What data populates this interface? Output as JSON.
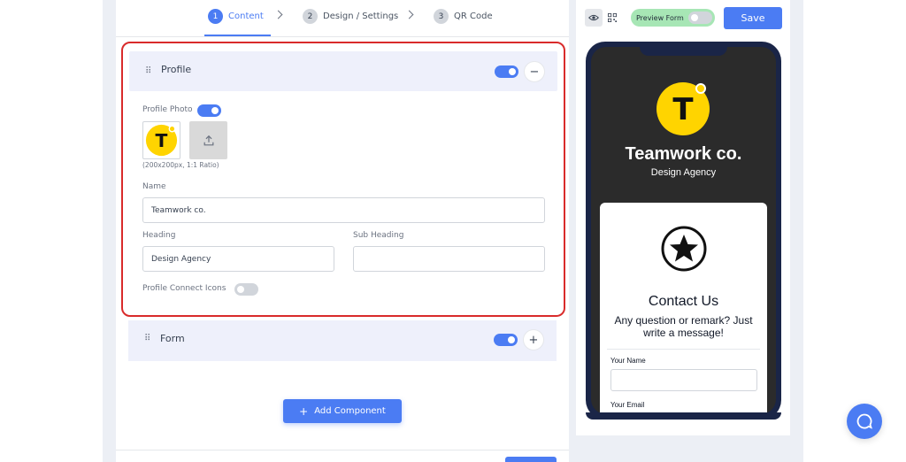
{
  "stepper": {
    "steps": [
      {
        "num": "1",
        "label": "Content"
      },
      {
        "num": "2",
        "label": "Design / Settings"
      },
      {
        "num": "3",
        "label": "QR Code"
      }
    ]
  },
  "profile": {
    "title": "Profile",
    "photo_label": "Profile Photo",
    "photo_hint": "(200x200px, 1:1 Ratio)",
    "name_label": "Name",
    "name_value": "Teamwork co.",
    "heading_label": "Heading",
    "heading_value": "Design Agency",
    "subheading_label": "Sub Heading",
    "subheading_value": "",
    "connect_icons_label": "Profile Connect Icons",
    "collapse_symbol": "−",
    "logo_letter": "T"
  },
  "form_section": {
    "title": "Form",
    "expand_symbol": "+"
  },
  "add_component": {
    "label": "Add Component",
    "icon_symbol": "+"
  },
  "toolbar": {
    "preview_label": "Preview Form",
    "save_label": "Save"
  },
  "preview": {
    "logo_letter": "T",
    "company_name": "Teamwork co.",
    "company_sub": "Design Agency",
    "contact_title": "Contact Us",
    "contact_sub": "Any question or remark? Just write a message!",
    "field1_label": "Your Name",
    "field2_label": "Your Email"
  },
  "colors": {
    "accent": "#4b7cf3",
    "logo_yellow": "#ffd400",
    "highlight_border": "#d92b2b",
    "preview_bg": "#2b2b2b",
    "phone_frame": "#1a2547"
  }
}
